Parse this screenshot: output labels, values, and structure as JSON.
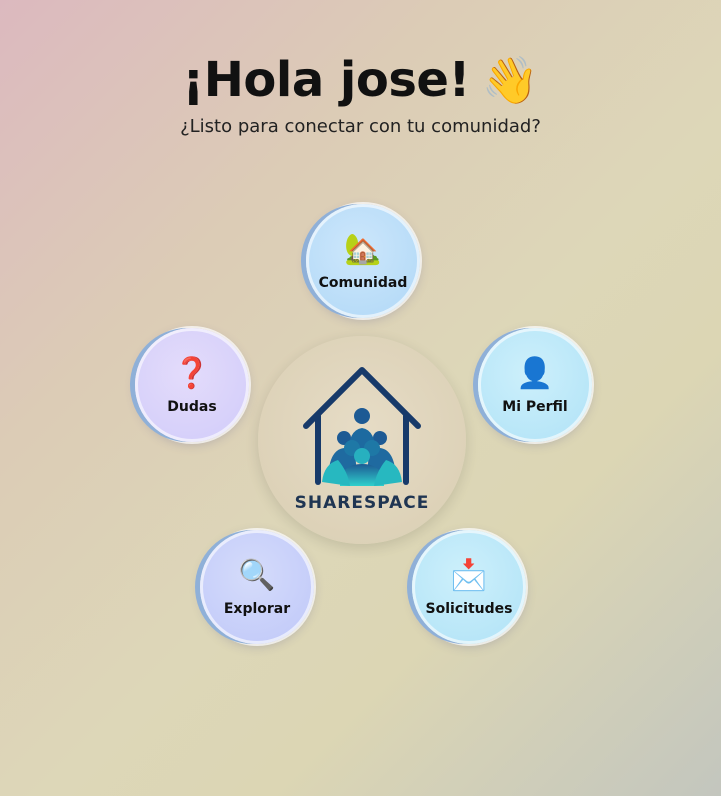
{
  "header": {
    "greeting": "¡Hola jose!",
    "wave_emoji": "👋",
    "subtitle": "¿Listo para conectar con tu comunidad?"
  },
  "logo": {
    "brand": "SHARESPACE",
    "colors": {
      "roof": "#173a6a",
      "people_dark": "#1d6e9e",
      "people_light": "#2ec4c4"
    }
  },
  "menu": {
    "comunidad": {
      "icon": "🏡",
      "icon_name": "house-icon",
      "label": "Comunidad"
    },
    "perfil": {
      "icon": "👤",
      "icon_name": "user-icon",
      "label": "Mi Perfil"
    },
    "dudas": {
      "icon": "❓",
      "icon_name": "question-icon",
      "label": "Dudas"
    },
    "explorar": {
      "icon": "🔍",
      "icon_name": "search-icon",
      "label": "Explorar"
    },
    "solicitudes": {
      "icon": "📩",
      "icon_name": "envelope-icon",
      "label": "Solicitudes"
    }
  }
}
